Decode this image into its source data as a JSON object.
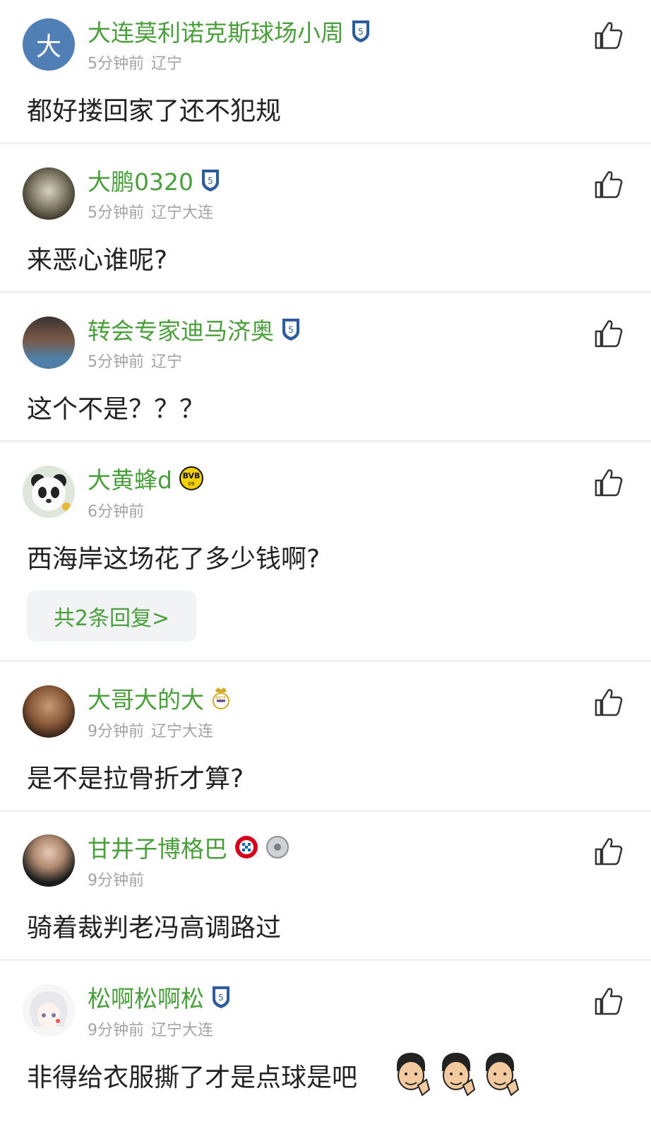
{
  "comments": [
    {
      "name": "大连莫利诺克斯球场小周",
      "time": "5分钟前",
      "location": "辽宁",
      "text": "都好搂回家了还不犯规",
      "avatar_letter": "大",
      "badges": [
        "dalian-crest"
      ]
    },
    {
      "name": "大鹏0320",
      "time": "5分钟前",
      "location": "辽宁大连",
      "text": "来恶心谁呢?",
      "badges": [
        "dalian-crest"
      ]
    },
    {
      "name": "转会专家迪马济奥",
      "time": "5分钟前",
      "location": "辽宁",
      "text": "这个不是？？？",
      "badges": [
        "dalian-crest"
      ]
    },
    {
      "name": "大黄蜂d",
      "time": "6分钟前",
      "location": "",
      "text": "西海岸这场花了多少钱啊?",
      "badges": [
        "bvb-crest"
      ],
      "reply_label": "共2条回复>"
    },
    {
      "name": "大哥大的大",
      "time": "9分钟前",
      "location": "辽宁大连",
      "text": "是不是拉骨折才算?",
      "badges": [
        "real-madrid-crest"
      ]
    },
    {
      "name": "甘井子博格巴",
      "time": "9分钟前",
      "location": "",
      "text": "骑着裁判老冯高调路过",
      "badges": [
        "bayern-crest",
        "ball-icon"
      ]
    },
    {
      "name": "松啊松啊松",
      "time": "9分钟前",
      "location": "辽宁大连",
      "text": "非得给衣服撕了才是点球是吧",
      "badges": [
        "dalian-crest"
      ]
    }
  ],
  "colors": {
    "name": "#4a9e3c",
    "meta": "#a3a3a3",
    "body": "#222222",
    "divider": "#f0f0f0"
  }
}
